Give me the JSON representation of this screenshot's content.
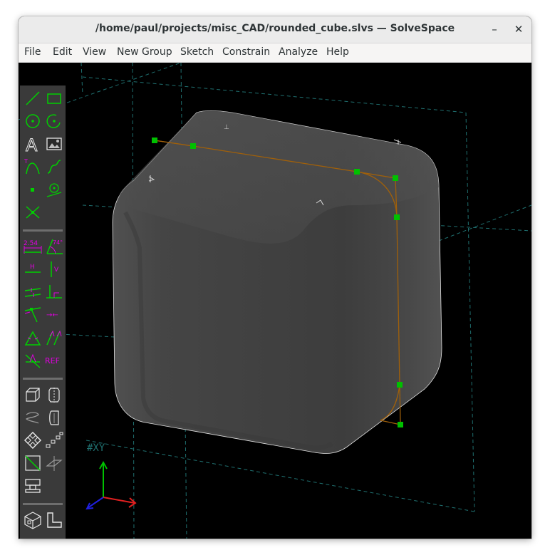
{
  "window": {
    "title": "/home/paul/projects/misc_CAD/rounded_cube.slvs — SolveSpace",
    "minimize_glyph": "–",
    "close_glyph": "✕"
  },
  "menu": {
    "items": [
      "File",
      "Edit",
      "View",
      "New Group",
      "Sketch",
      "Constrain",
      "Analyze",
      "Help"
    ]
  },
  "toolbar": {
    "sketch_tools": [
      "line-segment-icon",
      "rectangle-icon",
      "circle-icon",
      "arc-icon",
      "text-icon",
      "image-icon",
      "tangent-arc-icon",
      "cubic-spline-icon",
      "point-icon",
      "construction-point-icon",
      "split-curves-icon"
    ],
    "constraint_tools": [
      "distance-dimension-icon",
      "angle-dimension-icon",
      "horizontal-icon",
      "vertical-icon",
      "parallel-icon",
      "perpendicular-icon",
      "point-on-entity-icon",
      "symmetric-icon",
      "equal-length-icon",
      "orientation-icon",
      "other-supplementary-icon",
      "reference-icon"
    ],
    "group_tools": [
      "extrude-icon",
      "lathe-icon",
      "helix-icon",
      "revolve-icon",
      "linked-icon",
      "step-translate-icon",
      "nearest-iso-icon",
      "nearest-ortho-icon",
      "workplane-icon"
    ],
    "view_tools": [
      "isometric-view-icon",
      "ortho-view-icon"
    ],
    "dimension_text": "2.54",
    "angle_text": "74°",
    "h_text": "H",
    "v_text": "V",
    "ref_text": "REF"
  },
  "viewport": {
    "workplane_label": "#XY",
    "colors": {
      "background": "#000000",
      "solid": "#474747",
      "sketch_line": "#a0600a",
      "point": "#00c000",
      "grid": "#1f6f6f",
      "tool_green": "#00d000",
      "tool_magenta": "#e000e0"
    }
  }
}
